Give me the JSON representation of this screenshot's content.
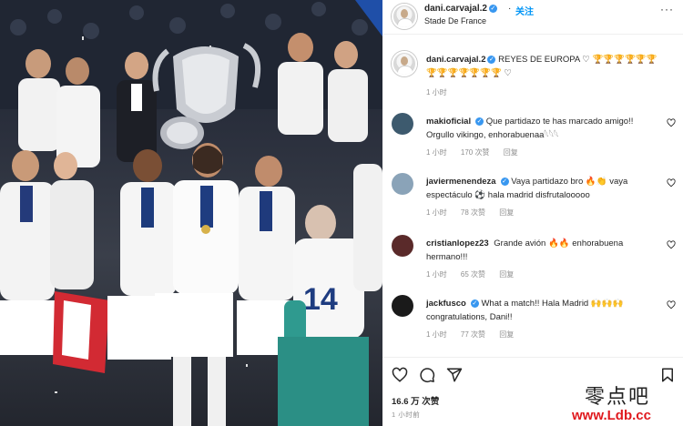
{
  "header": {
    "username": "dani.carvajal.2",
    "follow_label": "关注",
    "location": "Stade De France",
    "more_icon": "more-icon"
  },
  "caption": {
    "username": "dani.carvajal.2",
    "text": "REYES DE EUROPA ♡ 🏆🏆🏆🏆🏆🏆",
    "text_line2": "🏆🏆🏆🏆🏆🏆🏆 ♡",
    "time": "1 小时"
  },
  "comments": [
    {
      "username": "makioficial",
      "text": "Que partidazo te has marcado amigo!! Orgullo vikingo, enhorabuenaa𓆩𓆩𓆩",
      "time": "1 小时",
      "likes": "170 次赞",
      "reply": "回复",
      "avatar_color": "#3d5a6e"
    },
    {
      "username": "javiermenendeza",
      "text": "Vaya partidazo bro 🔥👏 vaya espectáculo ⚽ hala madrid disfrutalooooo",
      "time": "1 小时",
      "likes": "78 次赞",
      "reply": "回复",
      "avatar_color": "#8aa3b8"
    },
    {
      "username": "cristianlopez23",
      "text": "Grande avión 🔥🔥 enhorabuena hermano!!!",
      "time": "1 小时",
      "likes": "65 次赞",
      "reply": "回复",
      "avatar_color": "#5a2a2a"
    },
    {
      "username": "jackfusco",
      "text": "What a match!! Hala Madrid 🙌🙌🙌 congratulations, Dani!!",
      "time": "1 小时",
      "likes": "77 次赞",
      "reply": "回复",
      "avatar_color": "#1a1a1a"
    }
  ],
  "actions": {
    "likes": "16.6 万 次赞",
    "time": "1 小时前",
    "icons": [
      "heart-icon",
      "comment-icon",
      "share-icon",
      "bookmark-icon"
    ]
  },
  "watermark": {
    "cn": "零点吧",
    "url": "www.Ldb.cc"
  },
  "colors": {
    "link_blue": "#0095f6",
    "verified_blue": "#3897f0",
    "muted_gray": "#8e8e8e",
    "watermark_red": "#e0191e"
  }
}
